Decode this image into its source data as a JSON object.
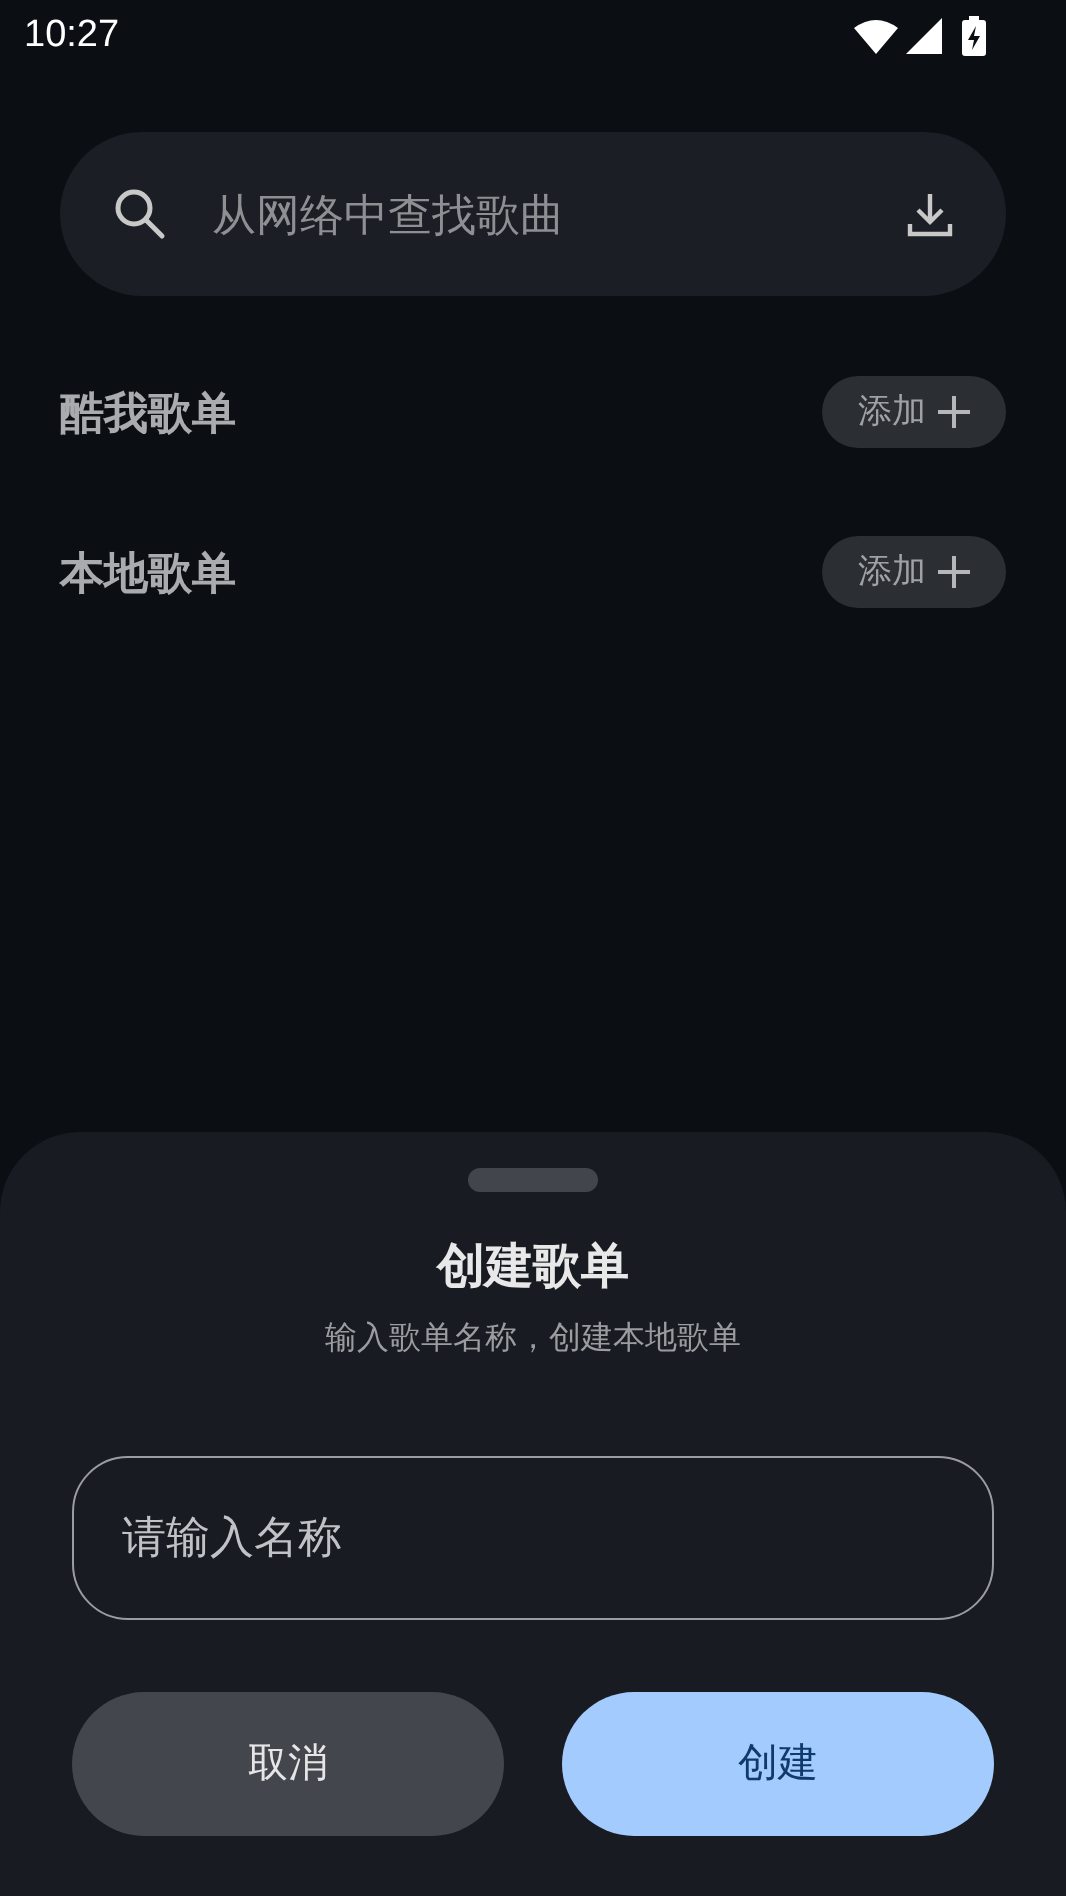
{
  "status_bar": {
    "time": "10:27"
  },
  "search": {
    "placeholder": "从网络中查找歌曲"
  },
  "sections": [
    {
      "title": "酷我歌单",
      "action": "添加"
    },
    {
      "title": "本地歌单",
      "action": "添加"
    }
  ],
  "sheet": {
    "title": "创建歌单",
    "subtitle": "输入歌单名称，创建本地歌单",
    "input": {
      "placeholder": "请输入名称"
    },
    "buttons": [
      {
        "label": "取消",
        "kind": "secondary"
      },
      {
        "label": "创建",
        "kind": "primary"
      }
    ]
  }
}
